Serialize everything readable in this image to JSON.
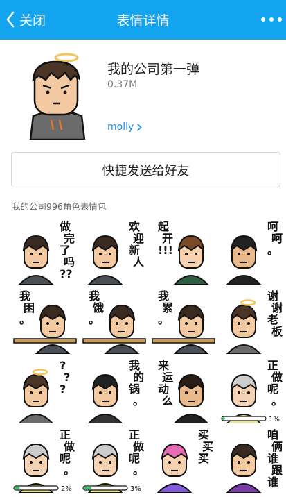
{
  "topbar": {
    "back_label": "关闭",
    "title": "表情详情"
  },
  "pack": {
    "name": "我的公司第一弹",
    "size": "0.37M",
    "author": "molly"
  },
  "actions": {
    "send_label": "快捷发送给好友"
  },
  "section": {
    "label": "我的公司996角色表情包"
  },
  "stickers": [
    {
      "caption": [
        "做",
        "完",
        "了",
        "吗",
        "??"
      ]
    },
    {
      "caption": [
        "欢",
        "迎",
        "新",
        "人"
      ]
    },
    {
      "caption": [
        "起",
        "开",
        "!!!"
      ]
    },
    {
      "caption": [
        "呵",
        "呵",
        "。"
      ]
    },
    {
      "caption": [
        "我",
        "困",
        "。"
      ]
    },
    {
      "caption": [
        "我",
        "饿",
        "。"
      ]
    },
    {
      "caption": [
        "我",
        "累",
        "。"
      ]
    },
    {
      "caption": [
        "谢",
        "谢",
        "老",
        "板"
      ]
    },
    {
      "caption": [
        "?",
        "?",
        "?"
      ]
    },
    {
      "caption": [
        "我",
        "的",
        "锅",
        "。"
      ]
    },
    {
      "caption": [
        "来",
        "运",
        "动",
        "么"
      ]
    },
    {
      "caption": [
        "正",
        "做",
        "呢",
        "。"
      ],
      "progress": "1%"
    },
    {
      "caption": [
        "正",
        "做",
        "呢",
        "。"
      ],
      "progress": "2%"
    },
    {
      "caption": [
        "正",
        "做",
        "呢",
        "。"
      ],
      "progress": "3%"
    },
    {
      "caption": [
        "买",
        "买",
        "买"
      ]
    },
    {
      "caption": [
        "咱",
        "俩",
        "谁",
        "跟",
        "谁"
      ]
    }
  ]
}
